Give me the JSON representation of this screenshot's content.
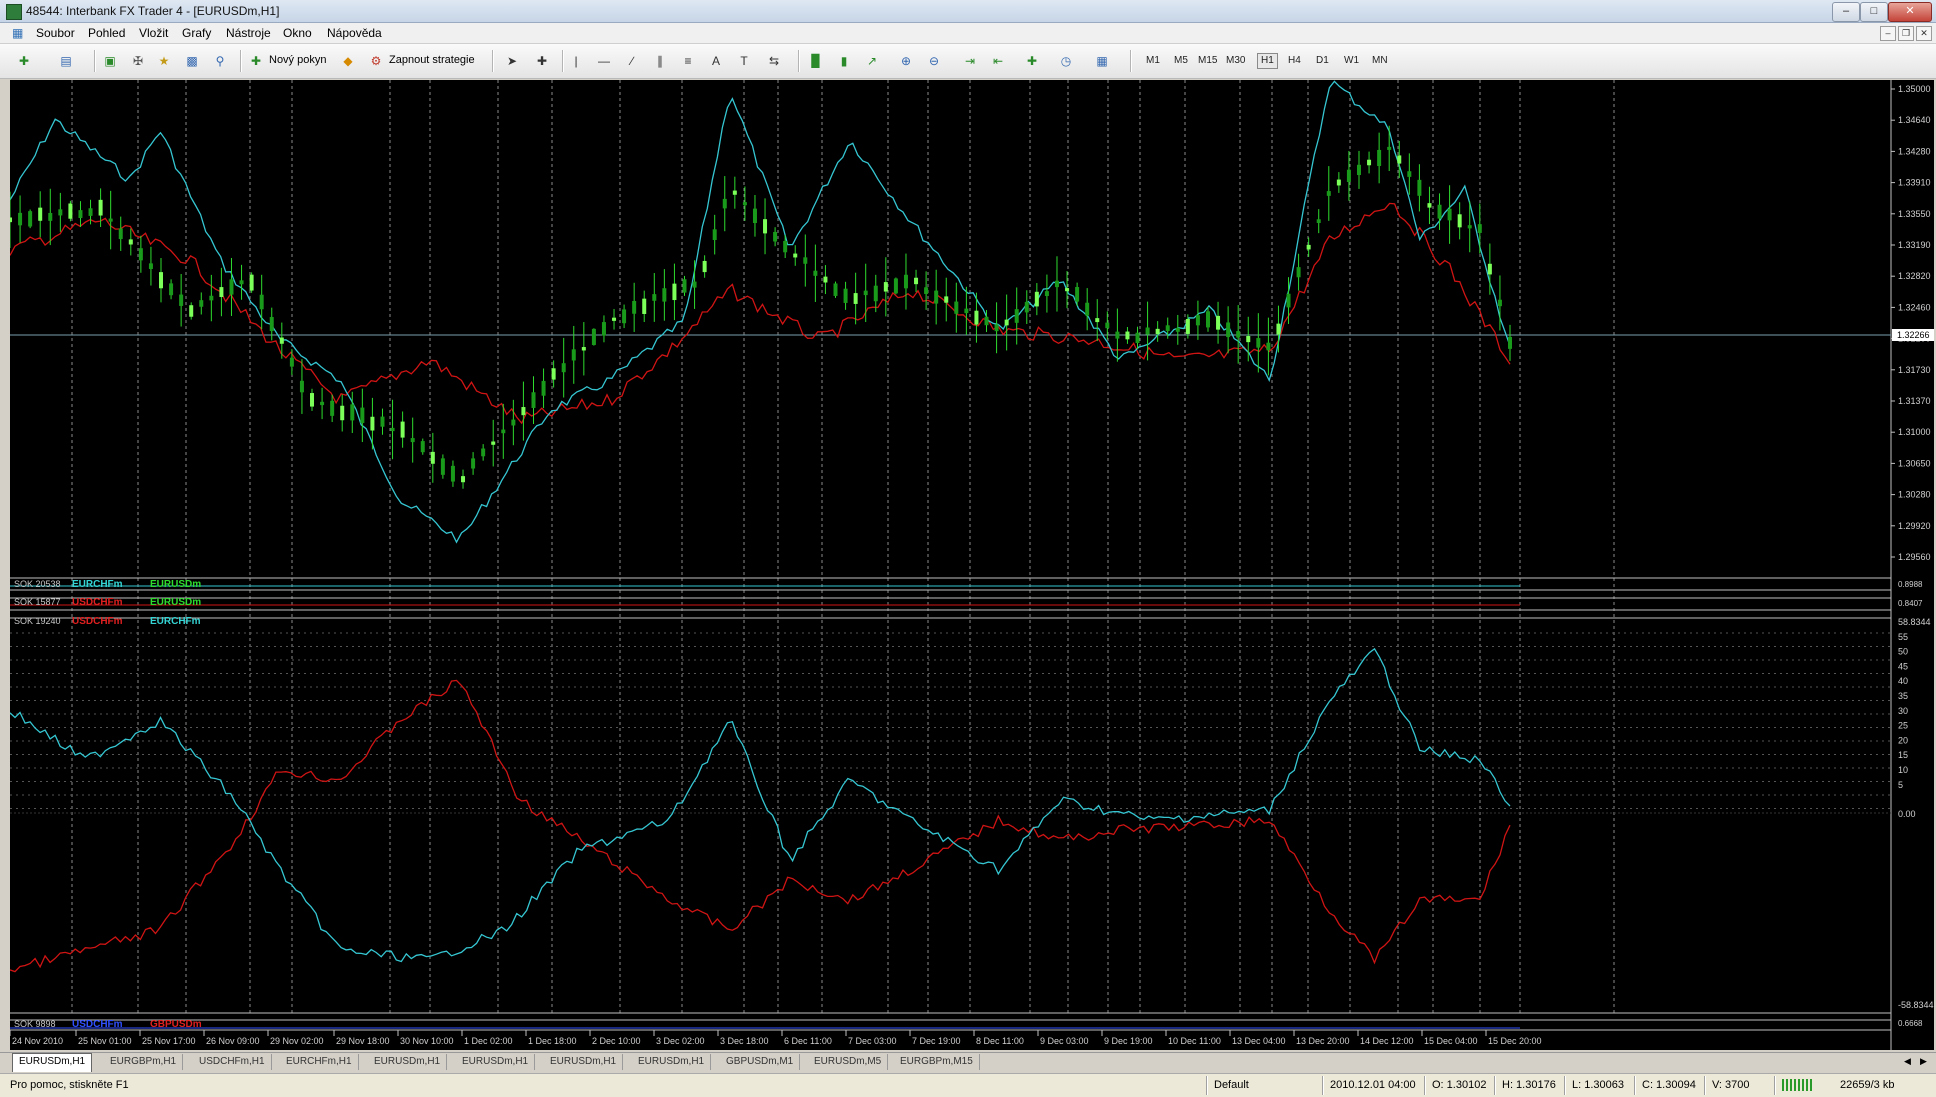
{
  "window": {
    "title": "48544: Interbank FX Trader 4 - [EURUSDm,H1]"
  },
  "menu": [
    "Soubor",
    "Pohled",
    "Vložit",
    "Grafy",
    "Nástroje",
    "Okno",
    "Nápověda"
  ],
  "toolbar": {
    "new_order": "Nový pokyn",
    "strategy": "Zapnout strategie",
    "timeframes": [
      "M1",
      "M5",
      "M15",
      "M30",
      "H1",
      "H4",
      "D1",
      "W1",
      "MN"
    ],
    "active_timeframe": "H1"
  },
  "chart": {
    "symbol": "EURUSDm,H1",
    "price_scale": [
      "1.35000",
      "1.34640",
      "1.34280",
      "1.33910",
      "1.33550",
      "1.33190",
      "1.32820",
      "1.32460",
      "1.32100",
      "1.31730",
      "1.31370",
      "1.31000",
      "1.30650",
      "1.30280",
      "1.29920",
      "1.29560"
    ],
    "current_price": "1.32266",
    "indicator_panels": [
      {
        "label": "SOK 20538",
        "legend": [
          "EURCHFm",
          "EURUSDm"
        ],
        "legend_colors": [
          "#35d4d4",
          "#2edc2e"
        ],
        "scale": [
          "0.8988",
          "0.8988"
        ]
      },
      {
        "label": "SOK 15877",
        "legend": [
          "USDCHFm",
          "EURUSDm"
        ],
        "legend_colors": [
          "#e02020",
          "#2edc2e"
        ],
        "scale": [
          "0.8407",
          "0.8407"
        ]
      },
      {
        "label": "SOK 19240",
        "legend": [
          "USDCHFm",
          "EURCHFm"
        ],
        "legend_colors": [
          "#e02020",
          "#35d4d4"
        ],
        "scale": [
          "58.8344",
          "55",
          "50",
          "45",
          "40",
          "35",
          "30",
          "25",
          "20",
          "15",
          "10",
          "5",
          "0.00",
          "-58.8344"
        ]
      },
      {
        "label": "SOK 9898",
        "legend": [
          "USDCHFm",
          "GBPUSDm"
        ],
        "legend_colors": [
          "#3050ff",
          "#e02020"
        ],
        "scale": [
          "0.6668",
          "0.6668"
        ]
      }
    ],
    "time_axis": [
      "24 Nov 2010",
      "25 Nov 01:00",
      "25 Nov 17:00",
      "26 Nov 09:00",
      "29 Nov 02:00",
      "29 Nov 18:00",
      "30 Nov 10:00",
      "1 Dec 02:00",
      "1 Dec 18:00",
      "2 Dec 10:00",
      "3 Dec 02:00",
      "3 Dec 18:00",
      "6 Dec 11:00",
      "7 Dec 03:00",
      "7 Dec 19:00",
      "8 Dec 11:00",
      "9 Dec 03:00",
      "9 Dec 19:00",
      "10 Dec 11:00",
      "13 Dec 04:00",
      "13 Dec 20:00",
      "14 Dec 12:00",
      "15 Dec 04:00",
      "15 Dec 20:00"
    ]
  },
  "tabs": [
    "EURUSDm,H1",
    "EURGBPm,H1",
    "USDCHFm,H1",
    "EURCHFm,H1",
    "EURUSDm,H1",
    "EURUSDm,H1",
    "EURUSDm,H1",
    "EURUSDm,H1",
    "GBPUSDm,M1",
    "EURUSDm,M5",
    "EURGBPm,M15"
  ],
  "active_tab": "EURUSDm,H1",
  "status": {
    "help": "Pro pomoc, stiskněte F1",
    "profile": "Default",
    "datetime": "2010.12.01 04:00",
    "open": "O: 1.30102",
    "high": "H: 1.30176",
    "low": "L: 1.30063",
    "close": "C: 1.30094",
    "volume": "V: 3700",
    "traffic": "22659/3 kb"
  }
}
